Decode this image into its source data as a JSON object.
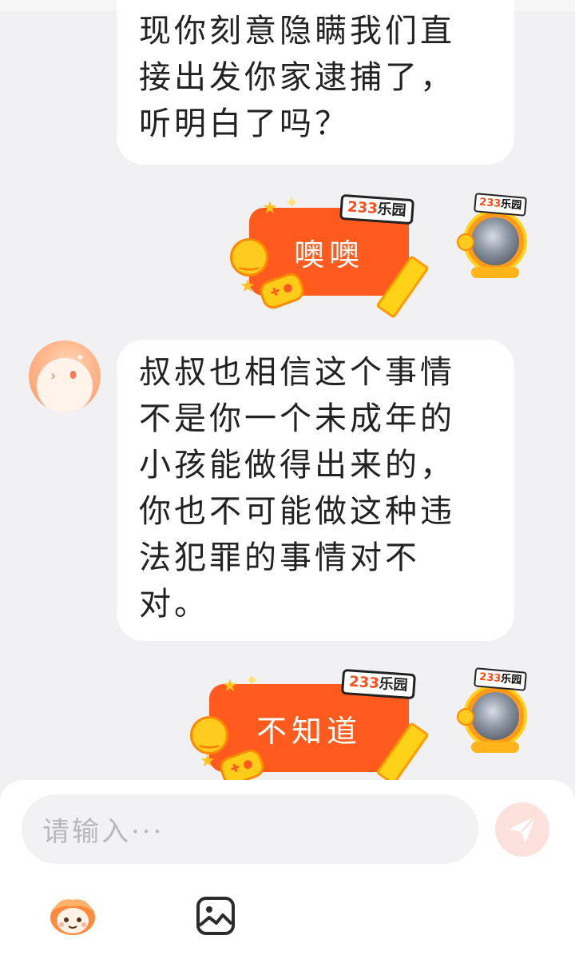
{
  "messages": [
    {
      "id": "m1",
      "from": "peer",
      "lines": [
        "现你刻意隐瞒我们直",
        "接出发你家逮捕了，",
        "听明白了吗？"
      ]
    },
    {
      "id": "m2",
      "from": "me",
      "sticker_text": "噢噢",
      "brand": "233乐园"
    },
    {
      "id": "m3",
      "from": "peer",
      "lines": [
        "叔叔也相信这个事情",
        "不是你一个未成年的",
        "小孩能做得出来的，",
        "你也不可能做这种违",
        "法犯罪的事情对不",
        "对。"
      ]
    },
    {
      "id": "m4",
      "from": "me",
      "sticker_text": "不知道",
      "brand": "233乐园"
    }
  ],
  "brand_parts": {
    "num": "233",
    "text": "乐园"
  },
  "input": {
    "placeholder": "请输入···"
  },
  "toolbar": {
    "mascot_icon": "mascot-emoji-icon",
    "image_icon": "image-icon",
    "send_icon": "send-icon"
  },
  "colors": {
    "background": "#f1f1f3",
    "bubble": "#ffffff",
    "sticker_orange": "#ff5b1f",
    "send_disabled": "#fde1dc",
    "send_icon": "#ffffff"
  }
}
